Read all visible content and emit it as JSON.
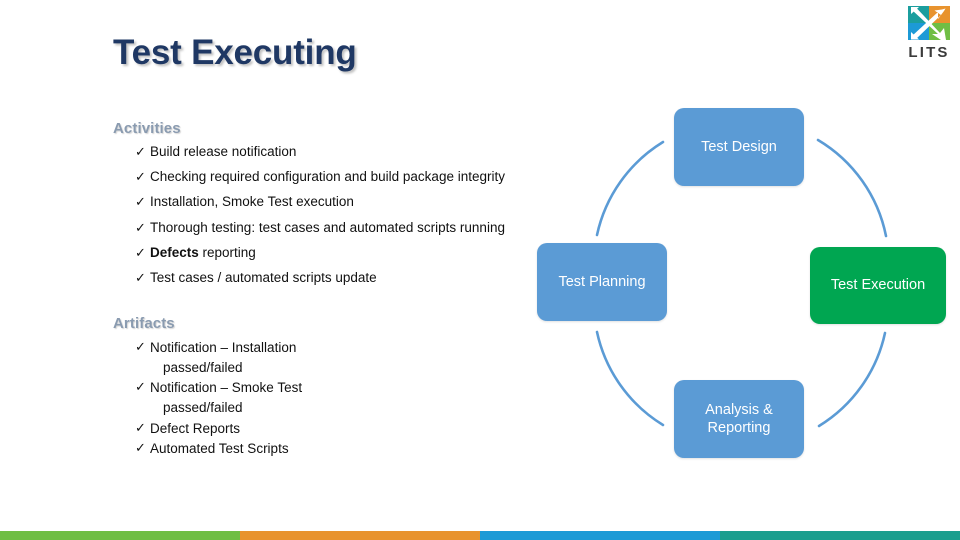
{
  "slide": {
    "title": "Test Executing"
  },
  "logo": {
    "name": "lits-logo",
    "text": "LITS",
    "quadrants": [
      {
        "name": "top-left",
        "color": "#1B9E9E"
      },
      {
        "name": "top-right",
        "color": "#E8932E"
      },
      {
        "name": "bottom-left",
        "color": "#1C9AD6"
      },
      {
        "name": "bottom-right",
        "color": "#6FBE44"
      }
    ]
  },
  "activities": {
    "heading": "Activities",
    "items": [
      {
        "text": "Build release notification"
      },
      {
        "text": "Checking required configuration and build package integrity"
      },
      {
        "text": "Installation, Smoke Test execution"
      },
      {
        "text": "Thorough testing: test cases and automated scripts running"
      },
      {
        "bold": "Defects",
        "text": " reporting"
      },
      {
        "text": "Test cases / automated scripts update"
      }
    ]
  },
  "artifacts": {
    "heading": "Artifacts",
    "items": [
      {
        "text": "Notification – Installation",
        "line2": "passed/failed"
      },
      {
        "text": "Notification – Smoke Test",
        "line2": "passed/failed"
      },
      {
        "text": "Defect Reports"
      },
      {
        "text": "Automated Test Scripts"
      }
    ]
  },
  "diagram": {
    "bullet_glyph": "✓",
    "arc_color": "#5B9BD5",
    "nodes": [
      {
        "id": "test-design",
        "label": "Test Design",
        "color": "#5B9BD5"
      },
      {
        "id": "test-execution",
        "label": "Test Execution",
        "color": "#00A651"
      },
      {
        "id": "analysis",
        "label_line1": "Analysis &",
        "label_line2": "Reporting",
        "color": "#5B9BD5"
      },
      {
        "id": "test-planning",
        "label": "Test Planning",
        "color": "#5B9BD5"
      }
    ]
  },
  "bottom_bar": {
    "segments": [
      {
        "name": "green",
        "color": "#6FBE44"
      },
      {
        "name": "orange",
        "color": "#E8932E"
      },
      {
        "name": "blue",
        "color": "#1C9AD6"
      },
      {
        "name": "teal",
        "color": "#1B9E8E"
      }
    ]
  }
}
